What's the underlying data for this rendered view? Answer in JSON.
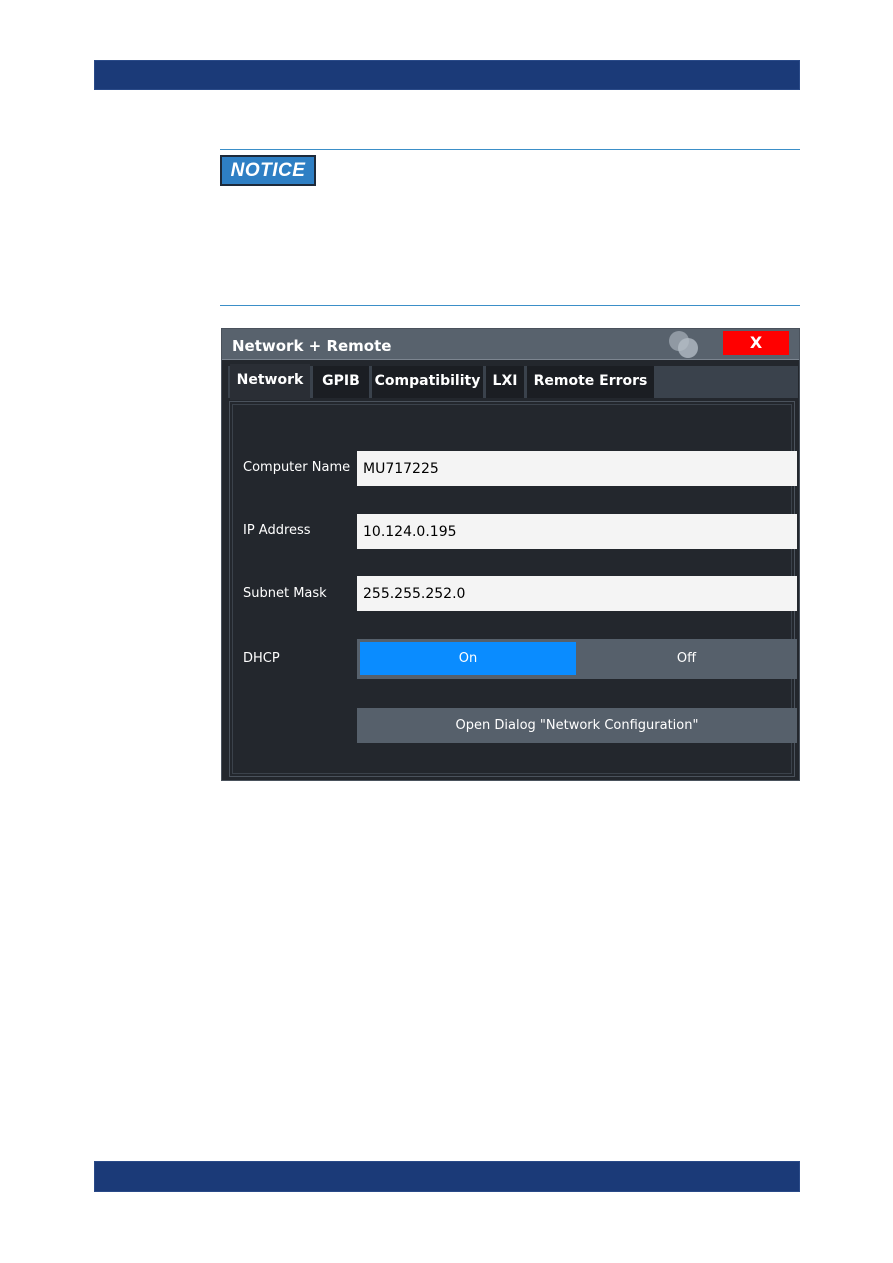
{
  "notice": {
    "badge_label": "NOTICE",
    "accent_color": "#2e7fc4"
  },
  "dialog": {
    "title": "Network + Remote",
    "close_label": "X",
    "close_color": "#ff0000",
    "tabs": [
      {
        "label": "Network",
        "active": true
      },
      {
        "label": "GPIB",
        "active": false
      },
      {
        "label": "Compatibility",
        "active": false
      },
      {
        "label": "LXI",
        "active": false
      },
      {
        "label": "Remote Errors",
        "active": false
      }
    ],
    "fields": {
      "computer_name": {
        "label": "Computer Name",
        "value": "MU717225"
      },
      "ip_address": {
        "label": "IP Address",
        "value": "10.124.0.195"
      },
      "subnet_mask": {
        "label": "Subnet Mask",
        "value": "255.255.252.0"
      }
    },
    "dhcp": {
      "label": "DHCP",
      "on_label": "On",
      "off_label": "Off",
      "selected": "On",
      "active_color": "#0a8cff"
    },
    "open_dialog_button": "Open Dialog \"Network Configuration\""
  }
}
